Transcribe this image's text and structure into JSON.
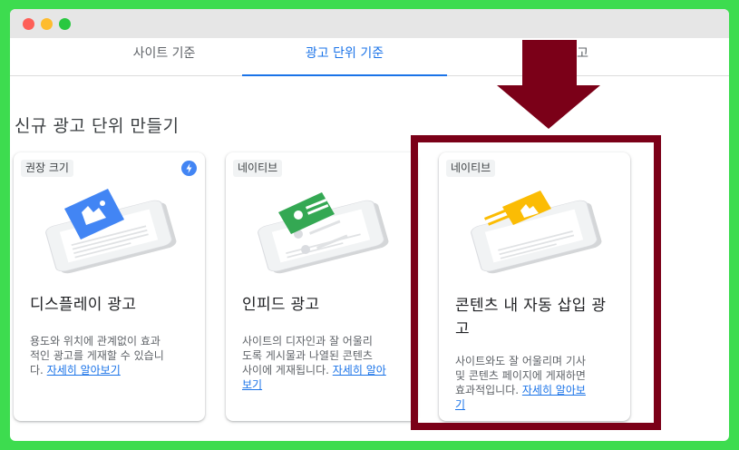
{
  "tabs": [
    {
      "label": "사이트 기준"
    },
    {
      "label": "광고 단위 기준"
    },
    {
      "label": "기존 광고"
    }
  ],
  "page_title": "신규 광고 단위 만들기",
  "cards": [
    {
      "chip": "권장 크기",
      "title": "디스플레이 광고",
      "desc_lines": [
        "용도와 위치에 관계없이 효과",
        "적인 광고를 게재할 수 있습니",
        "다. "
      ],
      "link": "자세히 알아보기",
      "accent": "#4285f4"
    },
    {
      "chip": "네이티브",
      "title": "인피드 광고",
      "desc_lines": [
        "사이트의 디자인과 잘 어울리",
        "도록 게시물과 나열된 콘텐츠",
        "사이에 게재됩니다. "
      ],
      "link1": "자세히 알아",
      "link2": "보기",
      "accent": "#34a853"
    },
    {
      "chip": "네이티브",
      "title_line1": "콘텐츠 내 자동 삽입 광",
      "title_line2": "고",
      "desc_lines": [
        "사이트와도 잘 어울리며 기사",
        "및 콘텐츠 페이지에 게재하면",
        "효과적입니다. "
      ],
      "link1": "자세히 알아보",
      "link2": "기",
      "accent": "#fbbc04"
    }
  ],
  "colors": {
    "background": "#3ddc4f",
    "highlight": "#7b0018",
    "active_tab": "#1a73e8"
  }
}
